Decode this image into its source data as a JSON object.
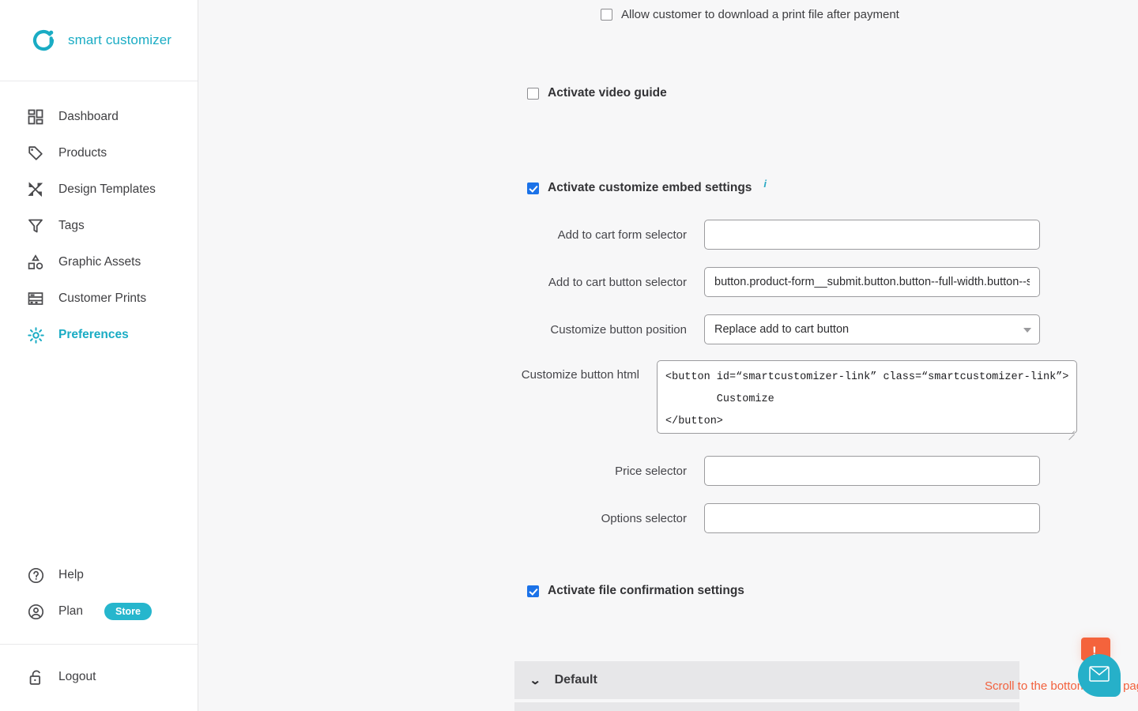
{
  "brand": {
    "name": "smart customizer",
    "logo_icon": "smart-customizer-logo",
    "accent_color": "#1aacc4"
  },
  "sidebar": {
    "items": [
      {
        "label": "Dashboard",
        "icon": "dashboard-grid-icon",
        "active": false
      },
      {
        "label": "Products",
        "icon": "tag-icon",
        "active": false
      },
      {
        "label": "Design Templates",
        "icon": "design-tools-icon",
        "active": false
      },
      {
        "label": "Tags",
        "icon": "funnel-icon",
        "active": false
      },
      {
        "label": "Graphic Assets",
        "icon": "shapes-icon",
        "active": false
      },
      {
        "label": "Customer Prints",
        "icon": "prints-grid-icon",
        "active": false
      },
      {
        "label": "Preferences",
        "icon": "gear-icon",
        "active": true
      }
    ],
    "bottom": {
      "help": {
        "label": "Help",
        "icon": "question-circle-icon"
      },
      "plan": {
        "label": "Plan",
        "icon": "user-circle-icon",
        "badge": "Store",
        "badge_color": "#26b6cd"
      },
      "logout": {
        "label": "Logout",
        "icon": "lock-icon"
      }
    }
  },
  "main": {
    "download_print_file": {
      "label": "Allow customer to download a print file after payment",
      "checked": false
    },
    "video_guide": {
      "label": "Activate video guide",
      "checked": false
    },
    "embed_settings": {
      "label": "Activate customize embed settings",
      "checked": true,
      "info_icon": "info-icon",
      "fields": {
        "add_to_cart_form_selector": {
          "label": "Add to cart form selector",
          "value": "",
          "placeholder": ""
        },
        "add_to_cart_button_selector": {
          "label": "Add to cart button selector",
          "value": "button.product-form__submit.button.button--full-width.button--s",
          "placeholder": ""
        },
        "customize_button_position": {
          "label": "Customize button position",
          "value": "Replace add to cart button",
          "caret_icon": "chevron-down-icon"
        },
        "customize_button_html": {
          "label": "Customize button html",
          "value": "<button id=“smartcustomizer-link” class=“smartcustomizer-link”>\n        Customize\n</button>"
        },
        "price_selector": {
          "label": "Price selector",
          "value": "",
          "placeholder": ""
        },
        "options_selector": {
          "label": "Options selector",
          "value": "",
          "placeholder": ""
        }
      }
    },
    "file_confirmation": {
      "label": "Activate file confirmation settings",
      "checked": true
    },
    "warning_badges": {
      "html_field_badge": {
        "glyph": "!",
        "color": "#f4633c",
        "icon": "warning-badge-icon"
      },
      "save_badge": {
        "glyph": "!",
        "color": "#f4633c",
        "icon": "warning-badge-icon"
      }
    },
    "panel": {
      "title": "Default",
      "chevron": "⌄",
      "chevron_icon": "chevron-down-icon"
    },
    "save_hint": {
      "text": "Scroll to the bottom of the page to Save",
      "color": "#f2603c"
    },
    "chat_widget": {
      "icon": "envelope-icon",
      "color": "#26b0c9"
    }
  }
}
